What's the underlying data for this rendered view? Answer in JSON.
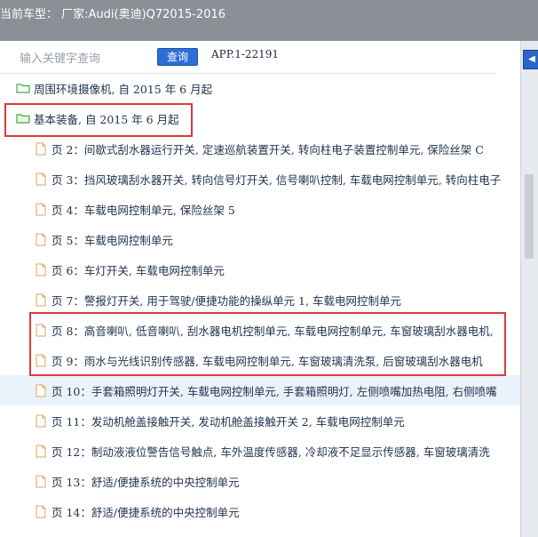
{
  "window": {
    "title": "当前车型：  厂家:Audi(奥迪)Q72015-2016"
  },
  "search": {
    "placeholder": "输入关键字查询",
    "button_label": "查询",
    "app_code": "APP.1-22191"
  },
  "tree": {
    "folders": [
      {
        "label": "周围环境摄像机, 自 2015 年 6 月起"
      },
      {
        "label": "基本装备, 自 2015 年 6 月起"
      }
    ],
    "pages": [
      {
        "label": "页 2：间歇式刮水器运行开关, 定速巡航装置开关, 转向柱电子装置控制单元, 保险丝架 C"
      },
      {
        "label": "页 3：挡风玻璃刮水器开关, 转向信号灯开关, 信号喇叭控制, 车载电网控制单元, 转向柱电子"
      },
      {
        "label": "页 4：车载电网控制单元, 保险丝架 5"
      },
      {
        "label": "页 5：车载电网控制单元"
      },
      {
        "label": "页 6：车灯开关, 车载电网控制单元"
      },
      {
        "label": "页 7：警报灯开关, 用于驾驶/便捷功能的操纵单元 1, 车载电网控制单元"
      },
      {
        "label": "页 8：高音喇叭, 低音喇叭, 刮水器电机控制单元, 车载电网控制单元, 车窗玻璃刮水器电机,"
      },
      {
        "label": "页 9：雨水与光线识别传感器, 车载电网控制单元, 车窗玻璃清洗泵, 后窗玻璃刮水器电机"
      },
      {
        "label": "页 10：手套箱照明灯开关, 车载电网控制单元, 手套箱照明灯, 左侧喷嘴加热电阻, 右侧喷嘴"
      },
      {
        "label": "页 11：发动机舱盖接触开关, 发动机舱盖接触开关 2, 车载电网控制单元"
      },
      {
        "label": "页 12：制动液液位警告信号触点, 车外温度传感器, 冷却液不足显示传感器, 车窗玻璃清洗"
      },
      {
        "label": "页 13：舒适/便捷系统的中央控制单元"
      },
      {
        "label": "页 14：舒适/便捷系统的中央控制单元"
      }
    ]
  },
  "colors": {
    "title_bar": "#8b8f96",
    "query_button": "#2f6ed6",
    "highlight_box": "#e03a3a",
    "folder_icon": "#46a83a",
    "page_icon": "#e0a45a",
    "selected_row": "#eaf2fb"
  }
}
